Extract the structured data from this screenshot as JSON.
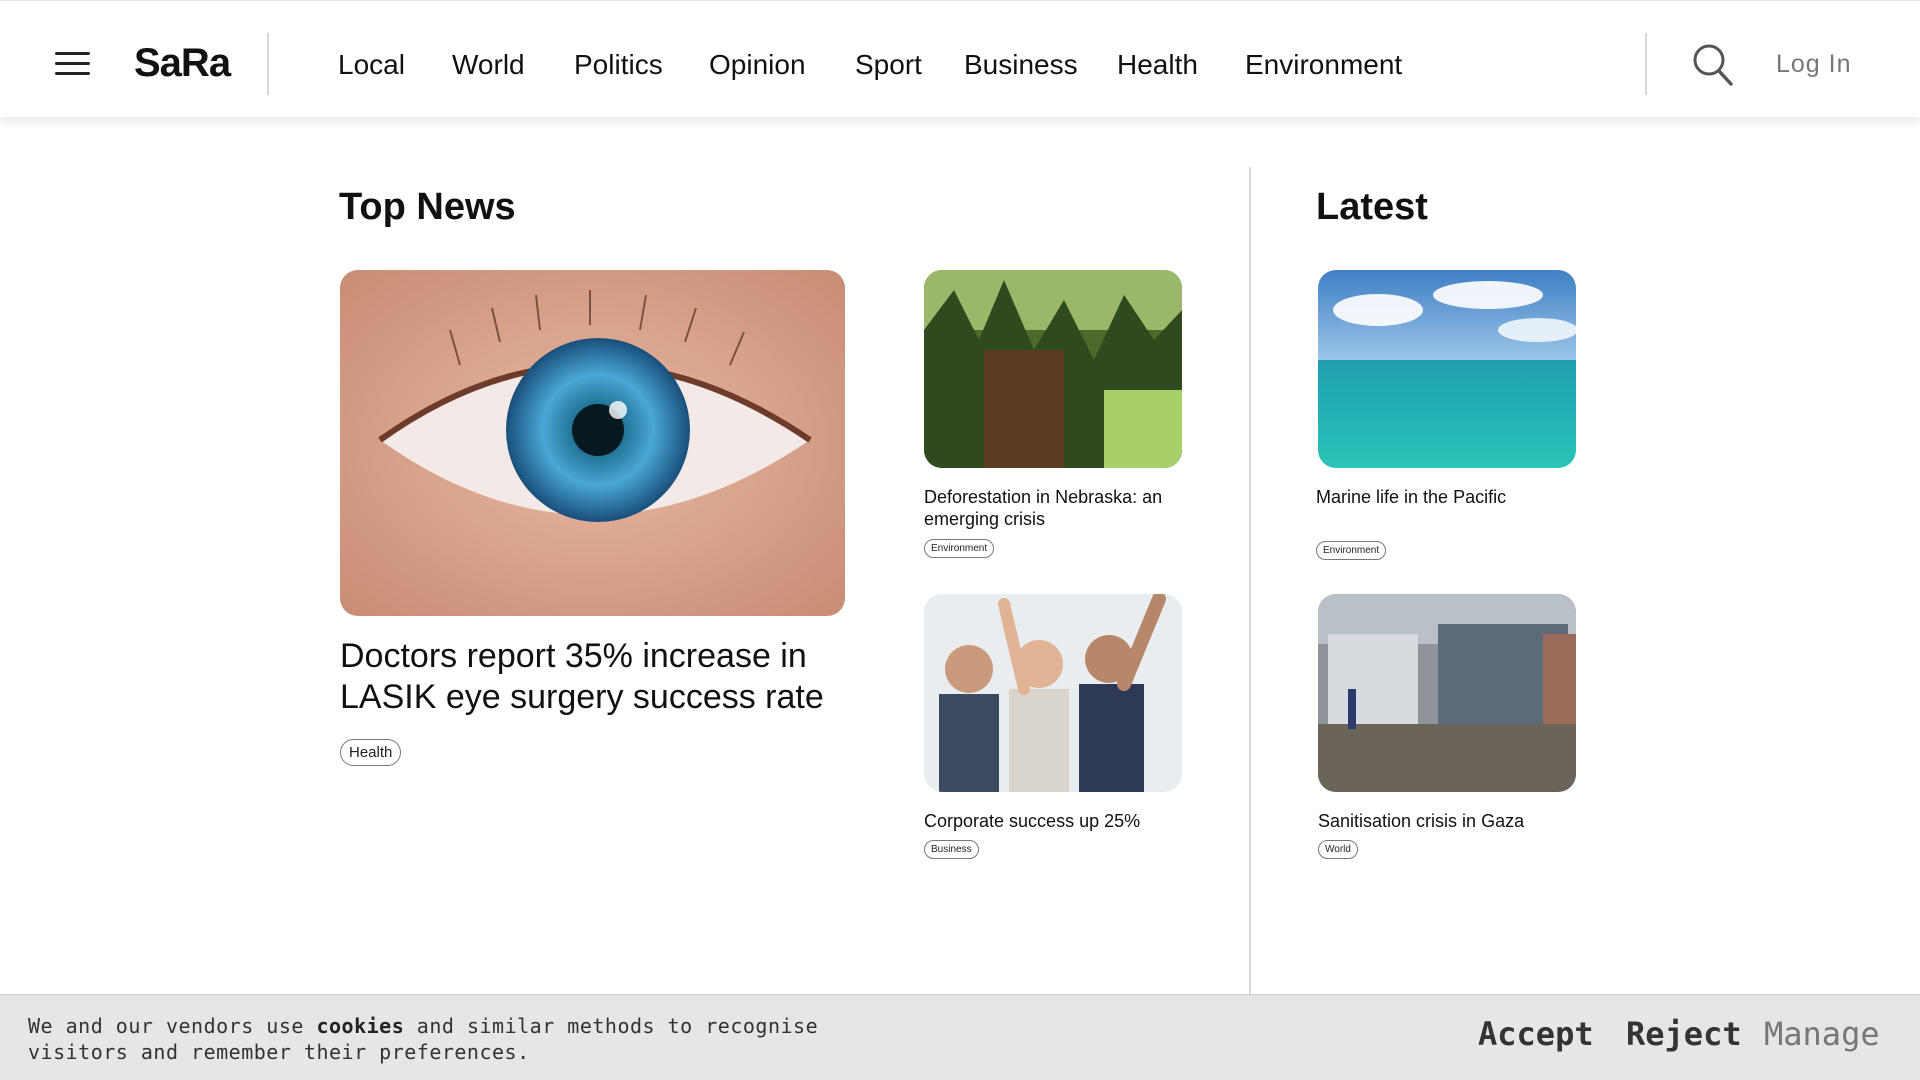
{
  "header": {
    "logo": "SaRa",
    "nav": [
      "Local",
      "World",
      "Politics",
      "Opinion",
      "Sport",
      "Business",
      "Health",
      "Environment"
    ],
    "login_label": "Log In"
  },
  "top_news": {
    "title": "Top News",
    "main_story": {
      "headline": "Doctors report 35% increase in LASIK eye surgery success rate",
      "tag": "Health",
      "image": "eye-closeup"
    },
    "side_stories": [
      {
        "headline": "Deforestation in Nebraska: an emerging crisis",
        "tag": "Environment",
        "image": "forest"
      },
      {
        "headline": "Corporate success up 25%",
        "tag": "Business",
        "image": "celebrating-team"
      }
    ]
  },
  "latest": {
    "title": "Latest",
    "stories": [
      {
        "headline": "Marine life in the Pacific",
        "tag": "Environment",
        "image": "ocean"
      },
      {
        "headline": "Sanitisation crisis in Gaza",
        "tag": "World",
        "image": "camp"
      }
    ]
  },
  "cookie_bar": {
    "text_pre": "We and our vendors use ",
    "text_bold": "cookies",
    "text_post": " and similar methods to recognise visitors and remember their preferences.",
    "accept": "Accept",
    "reject": "Reject",
    "manage": "Manage"
  },
  "colors": {
    "accent_dark": "#222222",
    "muted": "#777777",
    "cookie_bg": "#e6e6e6"
  }
}
